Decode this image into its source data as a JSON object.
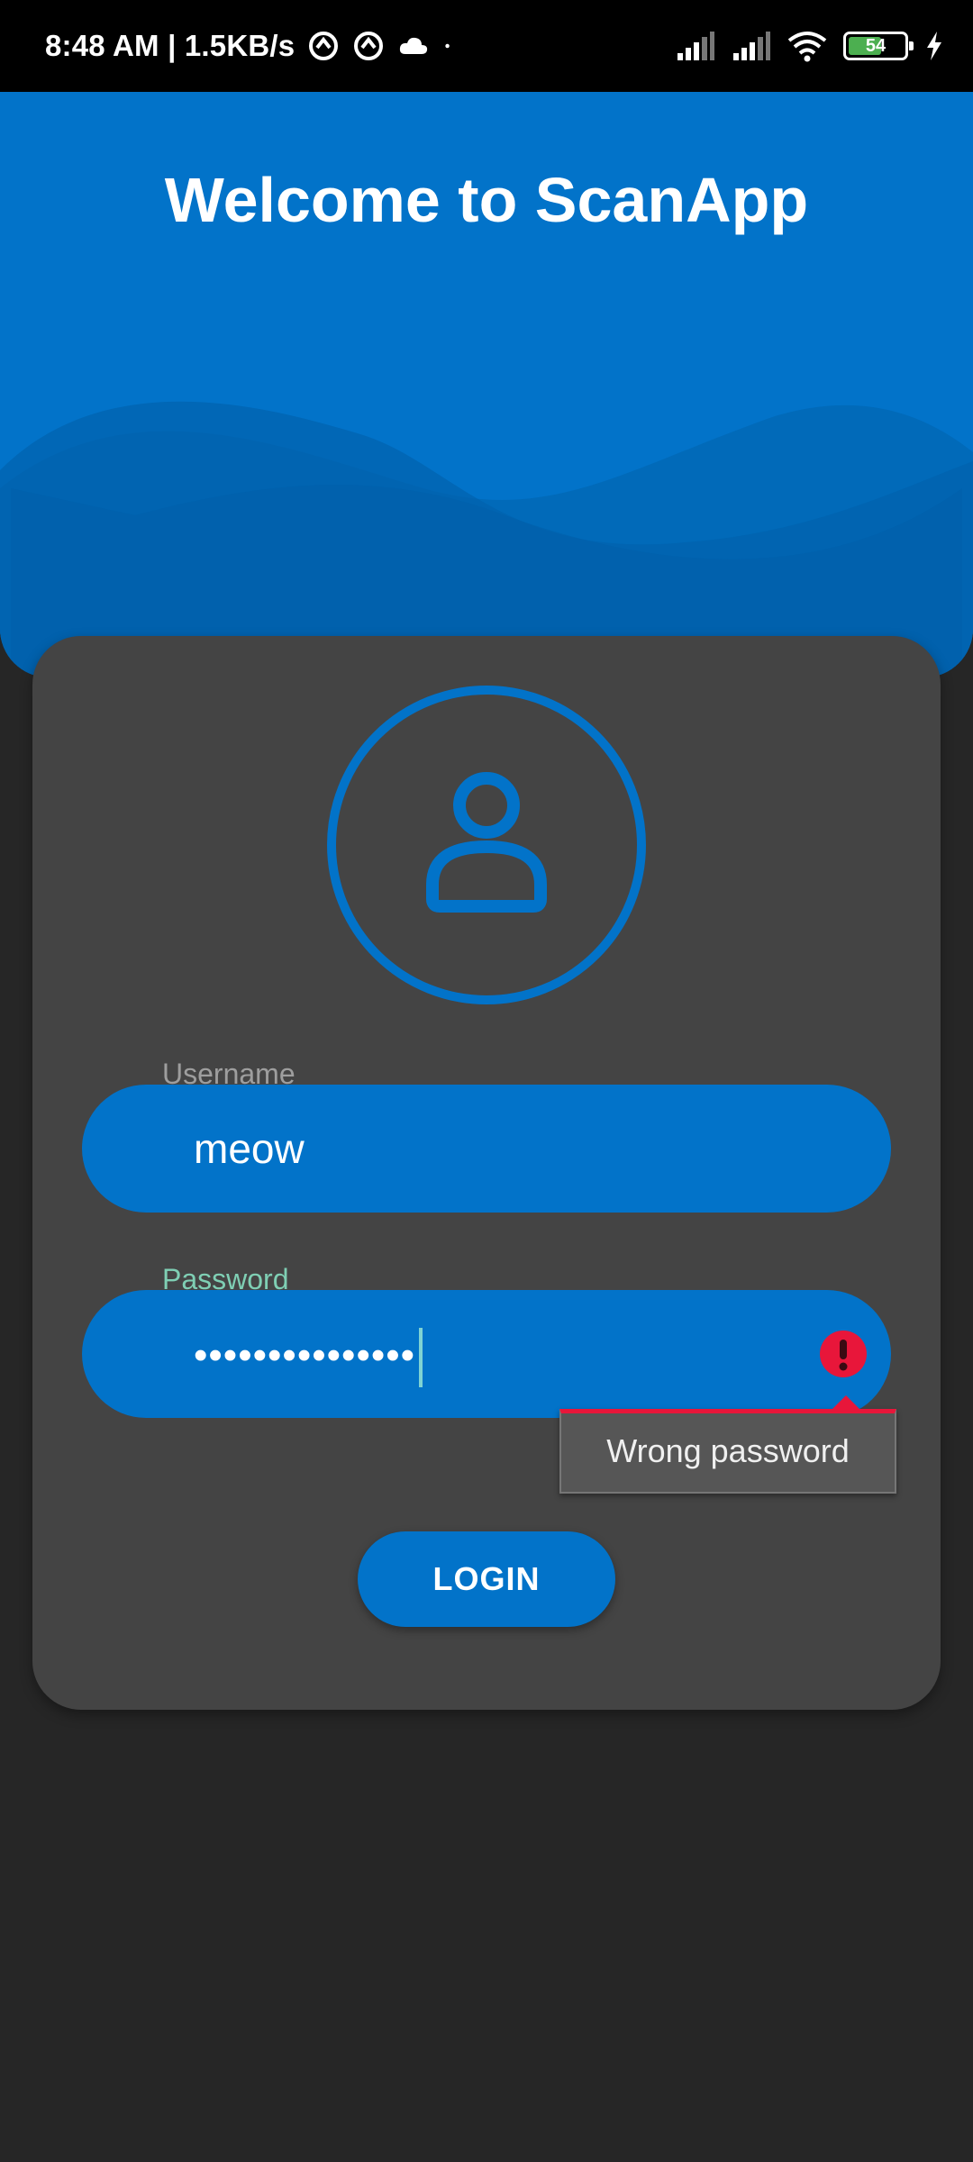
{
  "status_bar": {
    "time_and_speed": "8:48 AM | 1.5KB/s",
    "battery_level": "54",
    "icons": [
      "sync-icon",
      "sync-icon",
      "cloud-icon",
      "dot-icon",
      "signal-icon",
      "signal-icon",
      "wifi-icon",
      "battery-icon",
      "charging-icon"
    ]
  },
  "header": {
    "title": "Welcome to ScanApp"
  },
  "login_form": {
    "avatar_icon": "user-icon",
    "username": {
      "label": "Username",
      "value": "meow",
      "label_color": "#9e9e9e"
    },
    "password": {
      "label": "Password",
      "masked_value": "•••••••••••••••",
      "label_color": "#7fcfb4",
      "error_icon": "error-icon",
      "error_message": "Wrong password"
    },
    "login_label": "LOGIN"
  },
  "colors": {
    "accent": "#0273c9",
    "card": "#444444",
    "background": "#262626",
    "error": "#e8163a"
  }
}
